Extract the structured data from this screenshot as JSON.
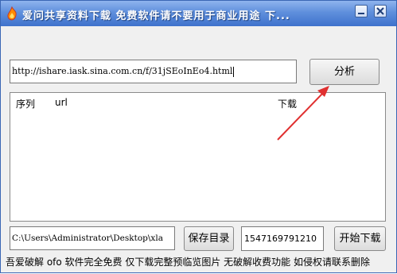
{
  "window": {
    "title": "爱问共享资料下载 免费软件请不要用于商业用途 下...",
    "app_icon": "fire-icon"
  },
  "url_field": {
    "value": "http://ishare.iask.sina.com.cn/f/31jSEoInEo4.html"
  },
  "buttons": {
    "analyze": "分析",
    "save_dir": "保存目录",
    "start_download": "开始下载"
  },
  "list": {
    "columns": [
      "序列",
      "url",
      "下载"
    ]
  },
  "path_field": {
    "value": "C:\\Users\\Administrator\\Desktop\\xla"
  },
  "id_field": {
    "value": "1547169791210"
  },
  "status_text": "吾爱破解 ofo 软件完全免费 仅下载完整预临览图片 无破解收费功能 如侵权请联系删除",
  "colors": {
    "titlebar": "#3f72cc",
    "arrow": "#e03030"
  }
}
